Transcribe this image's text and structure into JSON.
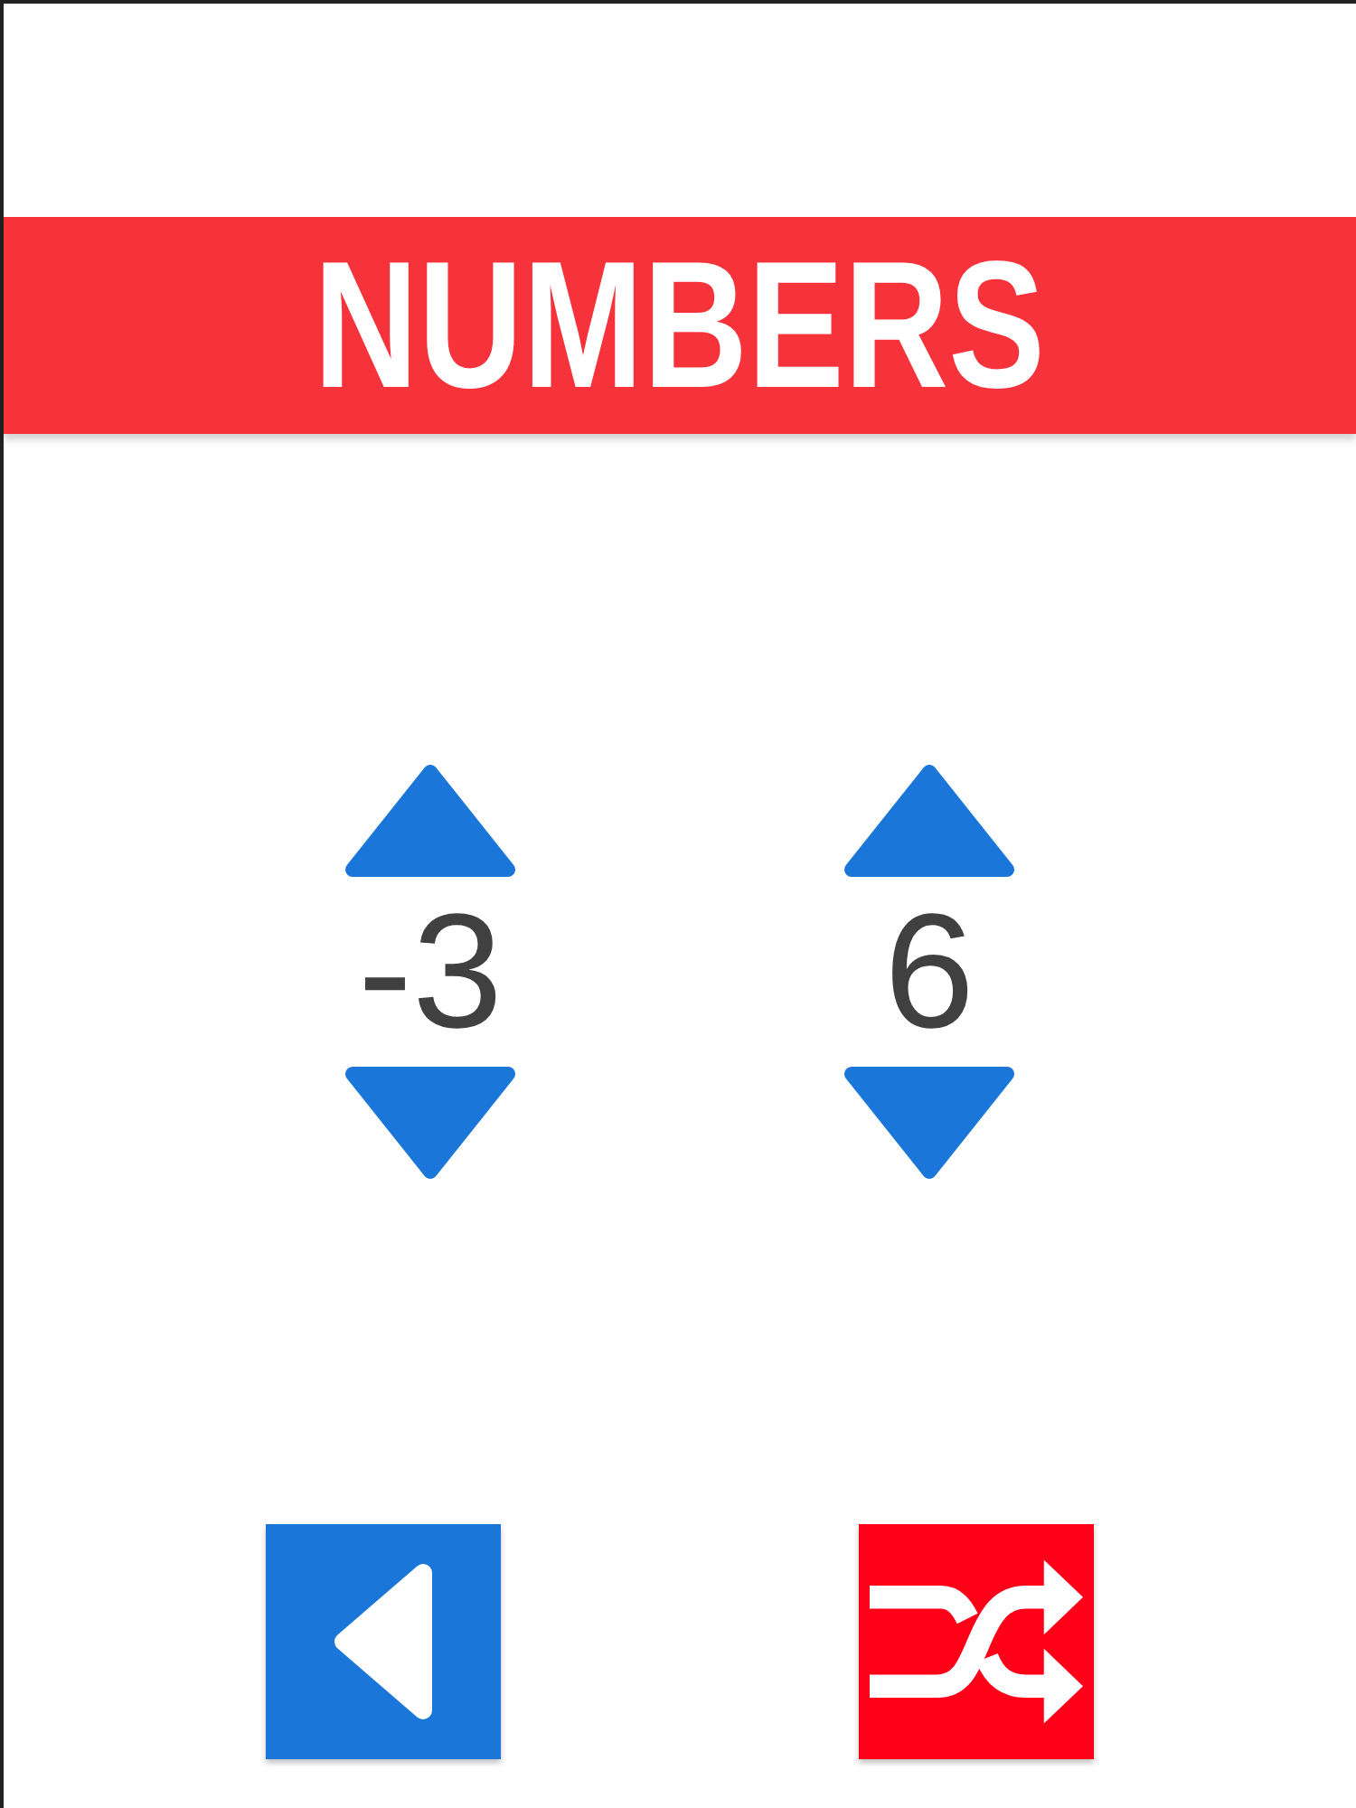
{
  "title": "NUMBERS",
  "spinners": [
    {
      "value": "-3"
    },
    {
      "value": "6"
    }
  ],
  "buttons": [
    {
      "kind": "back"
    },
    {
      "kind": "shuffle"
    }
  ]
}
